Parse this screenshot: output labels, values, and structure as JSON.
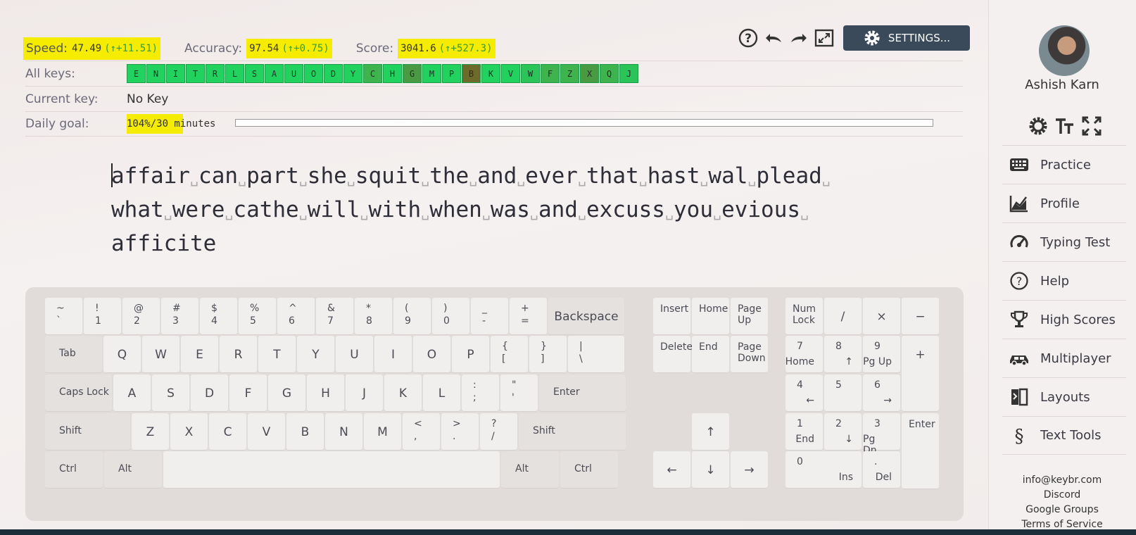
{
  "stats": {
    "speed_label": "Speed:",
    "speed_value": "47.49",
    "speed_delta": "(↑+11.51)",
    "accuracy_label": "Accuracy:",
    "accuracy_value": "97.54",
    "accuracy_delta": "(↑+0.75)",
    "score_label": "Score:",
    "score_value": "3041.6",
    "score_delta": "(↑+527.3)"
  },
  "all_keys": {
    "label": "All keys:",
    "keys": [
      {
        "char": "E",
        "color": "#22d25e"
      },
      {
        "char": "N",
        "color": "#22d25e"
      },
      {
        "char": "I",
        "color": "#22d25e"
      },
      {
        "char": "T",
        "color": "#22d25e"
      },
      {
        "char": "R",
        "color": "#22d25e"
      },
      {
        "char": "L",
        "color": "#22d25e"
      },
      {
        "char": "S",
        "color": "#22d25e"
      },
      {
        "char": "A",
        "color": "#22d25e"
      },
      {
        "char": "U",
        "color": "#22d25e"
      },
      {
        "char": "O",
        "color": "#22d25e"
      },
      {
        "char": "D",
        "color": "#22d25e"
      },
      {
        "char": "Y",
        "color": "#22d25e"
      },
      {
        "char": "C",
        "color": "#3fb34e"
      },
      {
        "char": "H",
        "color": "#22d25e"
      },
      {
        "char": "G",
        "color": "#4a9a44"
      },
      {
        "char": "M",
        "color": "#22d25e"
      },
      {
        "char": "P",
        "color": "#22d25e"
      },
      {
        "char": "B",
        "color": "#6d6a2b"
      },
      {
        "char": "K",
        "color": "#22d25e"
      },
      {
        "char": "V",
        "color": "#22d25e"
      },
      {
        "char": "W",
        "color": "#2bc458"
      },
      {
        "char": "F",
        "color": "#3fb34e"
      },
      {
        "char": "Z",
        "color": "#3fb34e"
      },
      {
        "char": "X",
        "color": "#4a9a44"
      },
      {
        "char": "Q",
        "color": "#3fb34e"
      },
      {
        "char": "J",
        "color": "#2bc458"
      }
    ]
  },
  "current_key": {
    "label": "Current key:",
    "value": "No Key"
  },
  "daily_goal": {
    "label": "Daily goal:",
    "value": "104%/30 minutes",
    "progress": 1.0
  },
  "toolbar": {
    "help_icon": "question-circle-icon",
    "undo_icon": "undo-icon",
    "redo_icon": "redo-icon",
    "fullscreen_icon": "fullscreen-icon",
    "settings_label": "SETTINGS..."
  },
  "text": {
    "lines": [
      [
        "affair",
        "can",
        "part",
        "she",
        "squit",
        "the",
        "and",
        "ever",
        "that",
        "hast",
        "wal",
        "plead"
      ],
      [
        "what",
        "were",
        "cathe",
        "will",
        "with",
        "when",
        "was",
        "and",
        "excuss",
        "you",
        "evious"
      ],
      [
        "afficite"
      ]
    ]
  },
  "keyboard": {
    "row1": [
      [
        "~",
        "`"
      ],
      [
        "!",
        "1"
      ],
      [
        "@",
        "2"
      ],
      [
        "#",
        "3"
      ],
      [
        "$",
        "4"
      ],
      [
        "%",
        "5"
      ],
      [
        "^",
        "6"
      ],
      [
        "&",
        "7"
      ],
      [
        "*",
        "8"
      ],
      [
        "(",
        "9"
      ],
      [
        ")",
        "0"
      ],
      [
        "_",
        "-"
      ],
      [
        "+",
        "="
      ]
    ],
    "backspace": "Backspace",
    "tab": "Tab",
    "row2": [
      "Q",
      "W",
      "E",
      "R",
      "T",
      "Y",
      "U",
      "I",
      "O",
      "P"
    ],
    "row2_sym": [
      [
        "{",
        "["
      ],
      [
        "}",
        "]"
      ],
      [
        "|",
        "\\"
      ]
    ],
    "caps": "Caps Lock",
    "row3": [
      "A",
      "S",
      "D",
      "F",
      "G",
      "H",
      "J",
      "K",
      "L"
    ],
    "row3_sym": [
      [
        ":",
        ";"
      ],
      [
        "\"",
        "'"
      ]
    ],
    "enter": "Enter",
    "shift": "Shift",
    "row4": [
      "Z",
      "X",
      "C",
      "V",
      "B",
      "N",
      "M"
    ],
    "row4_sym": [
      [
        "<",
        ","
      ],
      [
        ">",
        "."
      ],
      [
        "?",
        "/"
      ]
    ],
    "ctrl": "Ctrl",
    "alt": "Alt",
    "nav": {
      "insert": "Insert",
      "home": "Home",
      "page_up": [
        "Page",
        "Up"
      ],
      "delete": "Delete",
      "end": "End",
      "page_down": [
        "Page",
        "Down"
      ],
      "up": "↑",
      "left": "←",
      "down": "↓",
      "right": "→"
    },
    "numpad": {
      "numlock": [
        "Num",
        "Lock"
      ],
      "div": "/",
      "mul": "×",
      "minus": "−",
      "plus": "+",
      "enter": "Enter",
      "n7": [
        "7",
        "Home"
      ],
      "n8": [
        "8",
        "↑"
      ],
      "n9": [
        "9",
        "Pg Up"
      ],
      "n4": [
        "4",
        "←"
      ],
      "n5": [
        "5",
        ""
      ],
      "n6": [
        "6",
        "→"
      ],
      "n1": [
        "1",
        "End"
      ],
      "n2": [
        "2",
        "↓"
      ],
      "n3": [
        "3",
        "Pg Dn"
      ],
      "n0": [
        "0",
        "Ins"
      ],
      "dot": [
        ".",
        "Del"
      ]
    }
  },
  "sidebar": {
    "user_name": "Ashish Karn",
    "tools": [
      "theme-icon",
      "font-size-icon",
      "expand-icon"
    ],
    "nav": [
      {
        "label": "Practice",
        "icon": "keyboard-icon"
      },
      {
        "label": "Profile",
        "icon": "chart-icon"
      },
      {
        "label": "Typing Test",
        "icon": "speedometer-icon"
      },
      {
        "label": "Help",
        "icon": "help-icon"
      },
      {
        "label": "High Scores",
        "icon": "trophy-icon"
      },
      {
        "label": "Multiplayer",
        "icon": "car-icon"
      },
      {
        "label": "Layouts",
        "icon": "layouts-icon"
      },
      {
        "label": "Text Tools",
        "icon": "section-icon"
      }
    ],
    "footer": [
      "info@keybr.com",
      "Discord",
      "Google Groups",
      "Terms of Service"
    ]
  }
}
